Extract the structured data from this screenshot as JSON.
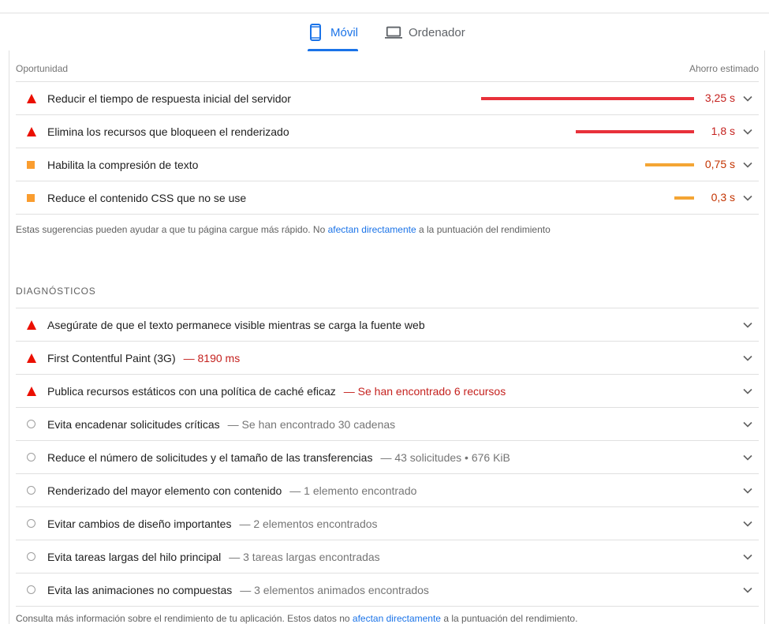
{
  "tabs": [
    {
      "label": "Móvil",
      "icon": "smartphone-icon",
      "active": true
    },
    {
      "label": "Ordenador",
      "icon": "laptop-icon",
      "active": false
    }
  ],
  "opportunities": {
    "header_left": "Oportunidad",
    "header_right": "Ahorro estimado",
    "items": [
      {
        "title": "Reducir el tiempo de respuesta inicial del servidor",
        "saving": "3,25 s",
        "saving_seconds": 3.25,
        "severity": "fail"
      },
      {
        "title": "Elimina los recursos que bloqueen el renderizado",
        "saving": "1,8 s",
        "saving_seconds": 1.8,
        "severity": "fail"
      },
      {
        "title": "Habilita la compresión de texto",
        "saving": "0,75 s",
        "saving_seconds": 0.75,
        "severity": "average"
      },
      {
        "title": "Reduce el contenido CSS que no se use",
        "saving": "0,3 s",
        "saving_seconds": 0.3,
        "severity": "average"
      }
    ],
    "note_before": "Estas sugerencias pueden ayudar a que tu página cargue más rápido. No ",
    "note_link": "afectan directamente",
    "note_after": " a la puntuación del rendimiento"
  },
  "diagnostics": {
    "title": "DIAGNÓSTICOS",
    "items": [
      {
        "title": "Asegúrate de que el texto permanece visible mientras se carga la fuente web",
        "detail": "",
        "severity": "fail"
      },
      {
        "title": "First Contentful Paint (3G)",
        "detail": "— 8190 ms",
        "severity": "fail"
      },
      {
        "title": "Publica recursos estáticos con una política de caché eficaz",
        "detail": "— Se han encontrado 6 recursos",
        "severity": "fail"
      },
      {
        "title": "Evita encadenar solicitudes críticas",
        "detail": "— Se han encontrado 30 cadenas",
        "severity": "info"
      },
      {
        "title": "Reduce el número de solicitudes y el tamaño de las transferencias",
        "detail": "— 43 solicitudes • 676 KiB",
        "severity": "info"
      },
      {
        "title": "Renderizado del mayor elemento con contenido",
        "detail": "— 1 elemento encontrado",
        "severity": "info"
      },
      {
        "title": "Evitar cambios de diseño importantes",
        "detail": "— 2 elementos encontrados",
        "severity": "info"
      },
      {
        "title": "Evita tareas largas del hilo principal",
        "detail": "— 3 tareas largas encontradas",
        "severity": "info"
      },
      {
        "title": "Evita las animaciones no compuestas",
        "detail": "— 3 elementos animados encontrados",
        "severity": "info"
      }
    ],
    "note_before": "Consulta más información sobre el rendimiento de tu aplicación. Estos datos no ",
    "note_link": "afectan directamente",
    "note_after": " a la puntuación del rendimiento."
  },
  "colors": {
    "accent": "#1a73e8",
    "fail": "#eb0f00",
    "average": "#fa9d2f",
    "fail_text": "#c5221f",
    "average_text": "#c33300"
  }
}
